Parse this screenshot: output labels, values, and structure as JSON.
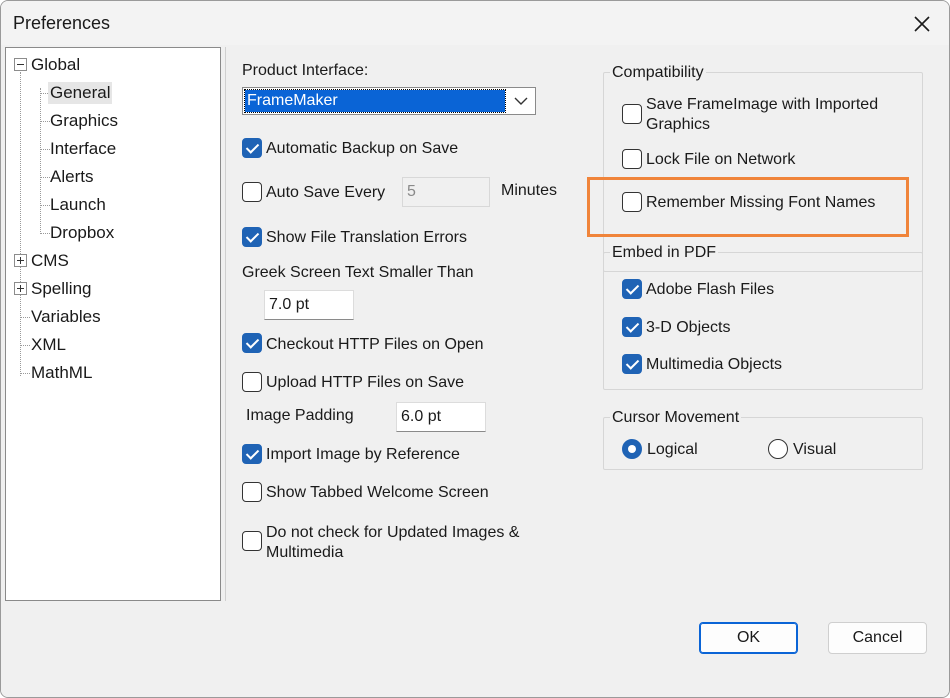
{
  "window": {
    "title": "Preferences",
    "close_icon": "close-icon"
  },
  "tree": {
    "items": [
      {
        "label": "Global",
        "expander": "minus"
      },
      {
        "label": "General",
        "selected": true
      },
      {
        "label": "Graphics"
      },
      {
        "label": "Interface"
      },
      {
        "label": "Alerts"
      },
      {
        "label": "Launch"
      },
      {
        "label": "Dropbox"
      },
      {
        "label": "CMS",
        "expander": "plus"
      },
      {
        "label": "Spelling",
        "expander": "plus"
      },
      {
        "label": "Variables"
      },
      {
        "label": "XML"
      },
      {
        "label": "MathML"
      }
    ]
  },
  "general": {
    "product_interface_label": "Product Interface:",
    "product_interface_value": "FrameMaker",
    "automatic_backup": {
      "label": "Automatic Backup on Save",
      "checked": true
    },
    "auto_save": {
      "label": "Auto Save Every",
      "checked": false,
      "value": "5",
      "unit": "Minutes"
    },
    "show_file_translation_errors": {
      "label": "Show File Translation Errors",
      "checked": true
    },
    "greek_label": "Greek Screen Text Smaller Than",
    "greek_value": "7.0 pt",
    "checkout_http": {
      "label": "Checkout HTTP Files on Open",
      "checked": true
    },
    "upload_http": {
      "label": "Upload HTTP Files on Save",
      "checked": false
    },
    "image_padding_label": "Image Padding",
    "image_padding_value": "6.0 pt",
    "import_image_by_reference": {
      "label": "Import Image by Reference",
      "checked": true
    },
    "show_tabbed_welcome": {
      "label": "Show Tabbed Welcome Screen",
      "checked": false
    },
    "do_not_check_updated": {
      "label_line1": "Do not check for Updated Images &",
      "label_line2": "Multimedia",
      "checked": false
    }
  },
  "compatibility": {
    "title": "Compatibility",
    "save_frameimage": {
      "label_line1": "Save FrameImage with Imported",
      "label_line2": "Graphics",
      "checked": false
    },
    "lock_file": {
      "label": "Lock File on Network",
      "checked": false
    },
    "remember_missing_font": {
      "label": "Remember Missing Font Names",
      "checked": false
    }
  },
  "embed_pdf": {
    "title": "Embed in PDF",
    "flash": {
      "label": "Adobe Flash Files",
      "checked": true
    },
    "objects_3d": {
      "label": "3-D Objects",
      "checked": true
    },
    "multimedia": {
      "label": "Multimedia Objects",
      "checked": true
    }
  },
  "cursor_movement": {
    "title": "Cursor Movement",
    "logical": {
      "label": "Logical",
      "selected": true
    },
    "visual": {
      "label": "Visual",
      "selected": false
    }
  },
  "footer": {
    "ok_label": "OK",
    "cancel_label": "Cancel"
  },
  "colors": {
    "accent": "#1f63b5",
    "highlight_box": "#f0843a",
    "selection": "#0a64d6"
  }
}
